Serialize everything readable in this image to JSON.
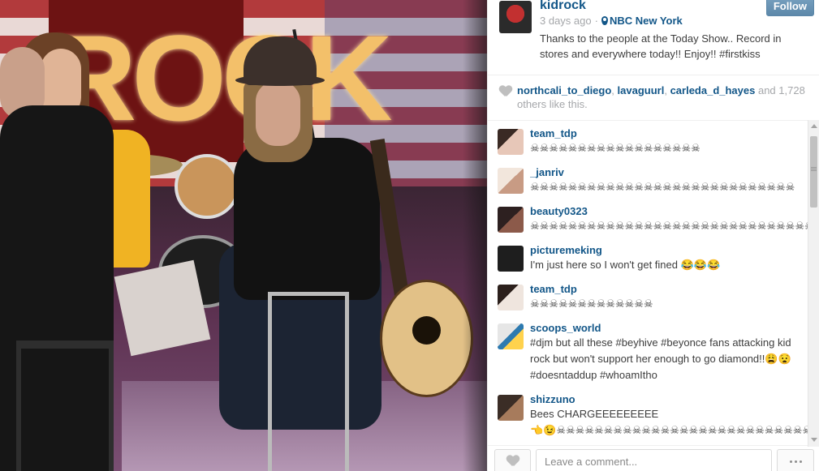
{
  "post": {
    "username": "kidrock",
    "time_ago": "3 days ago",
    "separator": "·",
    "location": "NBC New York",
    "caption": "Thanks to the people at the Today Show.. Record in stores and everywhere today!! Enjoy!! #firstkiss",
    "follow_label": "Follow",
    "icons": {
      "location": "map-pin-icon",
      "like": "heart-icon",
      "more": "ellipsis-icon"
    }
  },
  "photo": {
    "marquee_text": "ROCK"
  },
  "likes": {
    "users": [
      "northcali_to_diego",
      "lavaguurl",
      "carleda_d_hayes"
    ],
    "sep1": ", ",
    "sep2": ", ",
    "and_text": " and ",
    "count": "1,728",
    "suffix": " others like this."
  },
  "comments": [
    {
      "user": "team_tdp",
      "text": "☠☠☠☠☠☠☠☠☠☠☠☠☠☠☠☠☠☠"
    },
    {
      "user": "_janriv",
      "text": "☠☠☠☠☠☠☠☠☠☠☠☠☠☠☠☠☠☠☠☠☠☠☠☠☠☠☠☠"
    },
    {
      "user": "beauty0323",
      "text": "☠☠☠☠☠☠☠☠☠☠☠☠☠☠☠☠☠☠☠☠☠☠☠☠☠☠☠☠☠☠☠☠☠☠☠☠"
    },
    {
      "user": "picturemeking",
      "text": "I'm just here so I won't get fined 😂😂😂"
    },
    {
      "user": "team_tdp",
      "text": "☠☠☠☠☠☠☠☠☠☠☠☠☠"
    },
    {
      "user": "scoops_world",
      "text": "#djm but all these #beyhive #beyonce fans attacking kid rock but won't support her enough to go diamond!!😩😧 #doesntaddup #whoamItho"
    },
    {
      "user": "shizzuno",
      "text": "Bees CHARGEEEEEEEEE",
      "text2": "👈😉☠☠☠☠☠☠☠☠☠☠☠☠☠☠☠☠☠☠☠☠☠☠☠☠☠☠☠☠☠☠☠☠☠☠"
    }
  ],
  "footer": {
    "comment_placeholder": "Leave a comment..."
  }
}
